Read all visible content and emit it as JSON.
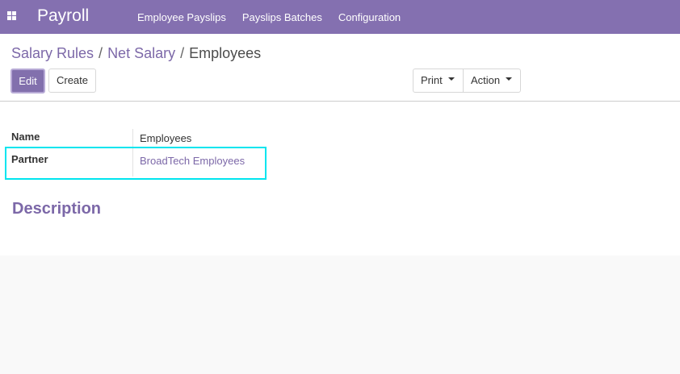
{
  "navbar": {
    "app_title": "Payroll",
    "menu": [
      {
        "label": "Employee Payslips"
      },
      {
        "label": "Payslips Batches"
      },
      {
        "label": "Configuration"
      }
    ]
  },
  "breadcrumb": {
    "items": [
      {
        "label": "Salary Rules"
      },
      {
        "label": "Net Salary"
      }
    ],
    "separator": "/",
    "current": "Employees"
  },
  "toolbar": {
    "edit_label": "Edit",
    "create_label": "Create",
    "print_label": "Print",
    "action_label": "Action"
  },
  "form": {
    "fields": [
      {
        "label": "Name",
        "value": "Employees"
      },
      {
        "label": "Partner",
        "value": "BroadTech Employees"
      }
    ],
    "section_title": "Description"
  },
  "colors": {
    "navbar": "#8470b0",
    "accent": "#7c68a8",
    "highlight": "#00e5ef"
  }
}
